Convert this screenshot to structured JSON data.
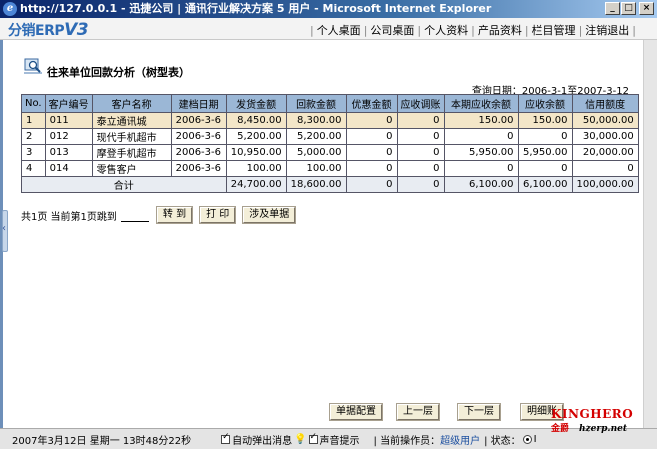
{
  "window": {
    "title": "http://127.0.0.1 - 迅捷公司  | 通讯行业解决方案 5 用户 - Microsoft Internet Explorer",
    "min_label": "_",
    "max_label": "□",
    "close_label": "×"
  },
  "header": {
    "logo_text": "分销ERP",
    "logo_version": "V3",
    "nav": [
      {
        "label": "个人桌面"
      },
      {
        "label": "公司桌面"
      },
      {
        "label": "个人资料"
      },
      {
        "label": "产品资料"
      },
      {
        "label": "栏目管理"
      },
      {
        "label": "注销退出"
      }
    ]
  },
  "report": {
    "title": "往来单位回款分析（树型表）",
    "query_date": "查询日期：2006-3-1至2007-3-12",
    "columns": [
      "No.",
      "客户编号",
      "客户名称",
      "建档日期",
      "发货金额",
      "回款金额",
      "优惠金额",
      "应收调账",
      "本期应收余额",
      "应收余额",
      "信用额度"
    ],
    "rows": [
      {
        "no": "1",
        "code": "011",
        "name": "泰立通讯城",
        "date": "2006-3-6",
        "shipped": "8,450.00",
        "received": "8,300.00",
        "discount": "0",
        "adjust": "0",
        "period_bal": "150.00",
        "bal": "150.00",
        "credit": "50,000.00"
      },
      {
        "no": "2",
        "code": "012",
        "name": "现代手机超市",
        "date": "2006-3-6",
        "shipped": "5,200.00",
        "received": "5,200.00",
        "discount": "0",
        "adjust": "0",
        "period_bal": "0",
        "bal": "0",
        "credit": "30,000.00"
      },
      {
        "no": "3",
        "code": "013",
        "name": "摩登手机超市",
        "date": "2006-3-6",
        "shipped": "10,950.00",
        "received": "5,000.00",
        "discount": "0",
        "adjust": "0",
        "period_bal": "5,950.00",
        "bal": "5,950.00",
        "credit": "20,000.00"
      },
      {
        "no": "4",
        "code": "014",
        "name": "零售客户",
        "date": "2006-3-6",
        "shipped": "100.00",
        "received": "100.00",
        "discount": "0",
        "adjust": "0",
        "period_bal": "0",
        "bal": "0",
        "credit": "0"
      }
    ],
    "total": {
      "label": "合计",
      "shipped": "24,700.00",
      "received": "18,600.00",
      "discount": "0",
      "adjust": "0",
      "period_bal": "6,100.00",
      "bal": "6,100.00",
      "credit": "100,000.00"
    }
  },
  "pager": {
    "info": "共1页 当前第1页跳到",
    "goto_label": "转 到",
    "print_label": "打 印",
    "docs_label": "涉及单据"
  },
  "bottom_buttons": {
    "config_label": "单据配置",
    "prev_label": "上一层",
    "next_label": "下一层",
    "detail_label": "明细账"
  },
  "status": {
    "datetime": "2007年3月12日 星期一 13时48分22秒",
    "auto_popup": "自动弹出消息",
    "sound_hint": "声音提示",
    "operator_label": "| 当前操作员：",
    "operator": "超级用户",
    "state_label": "| 状态：",
    "state_value": "I"
  },
  "watermark": {
    "brand": "KINGHERO",
    "cn": "金爵",
    "url": "hzerp.net"
  }
}
